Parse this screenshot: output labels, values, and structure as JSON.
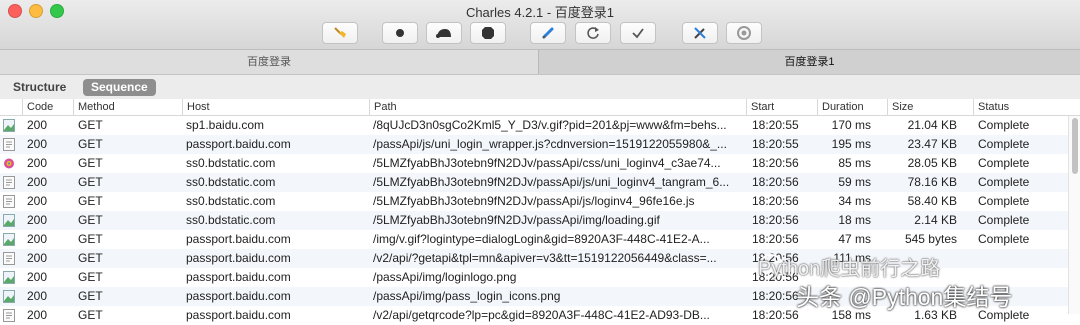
{
  "window": {
    "title": "Charles 4.2.1 - 百度登录1"
  },
  "toolbar": {
    "buttons": [
      "broom-icon",
      "record-icon",
      "throttle-icon",
      "breakpoint-icon",
      "compose-icon",
      "repeat-icon",
      "validate-icon",
      "tools-icon",
      "settings-icon"
    ]
  },
  "tabs": [
    {
      "label": "百度登录",
      "active": false
    },
    {
      "label": "百度登录1",
      "active": true
    }
  ],
  "view": {
    "structure": "Structure",
    "sequence": "Sequence"
  },
  "columns": {
    "code": "Code",
    "method": "Method",
    "host": "Host",
    "path": "Path",
    "start": "Start",
    "duration": "Duration",
    "size": "Size",
    "status": "Status"
  },
  "rows": [
    {
      "icon": "image-file-icon",
      "code": "200",
      "method": "GET",
      "host": "sp1.baidu.com",
      "path": "/8qUJcD3n0sgCo2Kml5_Y_D3/v.gif?pid=201&pj=www&fm=behs...",
      "start": "18:20:55",
      "duration": "170 ms",
      "size": "21.04 KB",
      "status": "Complete"
    },
    {
      "icon": "script-file-icon",
      "code": "200",
      "method": "GET",
      "host": "passport.baidu.com",
      "path": "/passApi/js/uni_login_wrapper.js?cdnversion=1519122055980&_...",
      "start": "18:20:55",
      "duration": "195 ms",
      "size": "23.47 KB",
      "status": "Complete"
    },
    {
      "icon": "css-file-icon",
      "code": "200",
      "method": "GET",
      "host": "ss0.bdstatic.com",
      "path": "/5LMZfyabBhJ3otebn9fN2DJv/passApi/css/uni_loginv4_c3ae74...",
      "start": "18:20:56",
      "duration": "85 ms",
      "size": "28.05 KB",
      "status": "Complete"
    },
    {
      "icon": "script-file-icon",
      "code": "200",
      "method": "GET",
      "host": "ss0.bdstatic.com",
      "path": "/5LMZfyabBhJ3otebn9fN2DJv/passApi/js/uni_loginv4_tangram_6...",
      "start": "18:20:56",
      "duration": "59 ms",
      "size": "78.16 KB",
      "status": "Complete"
    },
    {
      "icon": "script-file-icon",
      "code": "200",
      "method": "GET",
      "host": "ss0.bdstatic.com",
      "path": "/5LMZfyabBhJ3otebn9fN2DJv/passApi/js/loginv4_96fe16e.js",
      "start": "18:20:56",
      "duration": "34 ms",
      "size": "58.40 KB",
      "status": "Complete"
    },
    {
      "icon": "image-file-icon",
      "code": "200",
      "method": "GET",
      "host": "ss0.bdstatic.com",
      "path": "/5LMZfyabBhJ3otebn9fN2DJv/passApi/img/loading.gif",
      "start": "18:20:56",
      "duration": "18 ms",
      "size": "2.14 KB",
      "status": "Complete"
    },
    {
      "icon": "image-file-icon",
      "code": "200",
      "method": "GET",
      "host": "passport.baidu.com",
      "path": "/img/v.gif?logintype=dialogLogin&gid=8920A3F-448C-41E2-A...",
      "start": "18:20:56",
      "duration": "47 ms",
      "size": "545 bytes",
      "status": "Complete"
    },
    {
      "icon": "script-file-icon",
      "code": "200",
      "method": "GET",
      "host": "passport.baidu.com",
      "path": "/v2/api/?getapi&tpl=mn&apiver=v3&tt=1519122056449&class=...",
      "start": "18:20:56",
      "duration": "111 ms",
      "size": "",
      "status": ""
    },
    {
      "icon": "image-file-icon",
      "code": "200",
      "method": "GET",
      "host": "passport.baidu.com",
      "path": "/passApi/img/loginlogo.png",
      "start": "18:20:56",
      "duration": "",
      "size": "",
      "status": ""
    },
    {
      "icon": "image-file-icon",
      "code": "200",
      "method": "GET",
      "host": "passport.baidu.com",
      "path": "/passApi/img/pass_login_icons.png",
      "start": "18:20:56",
      "duration": "",
      "size": "",
      "status": ""
    },
    {
      "icon": "script-file-icon",
      "code": "200",
      "method": "GET",
      "host": "passport.baidu.com",
      "path": "/v2/api/getqrcode?lp=pc&gid=8920A3F-448C-41E2-AD93-DB...",
      "start": "18:20:56",
      "duration": "158 ms",
      "size": "1.63 KB",
      "status": "Complete"
    }
  ],
  "watermark": {
    "line1": "Python爬虫前行之路",
    "line2": "头条 @Python集结号"
  }
}
